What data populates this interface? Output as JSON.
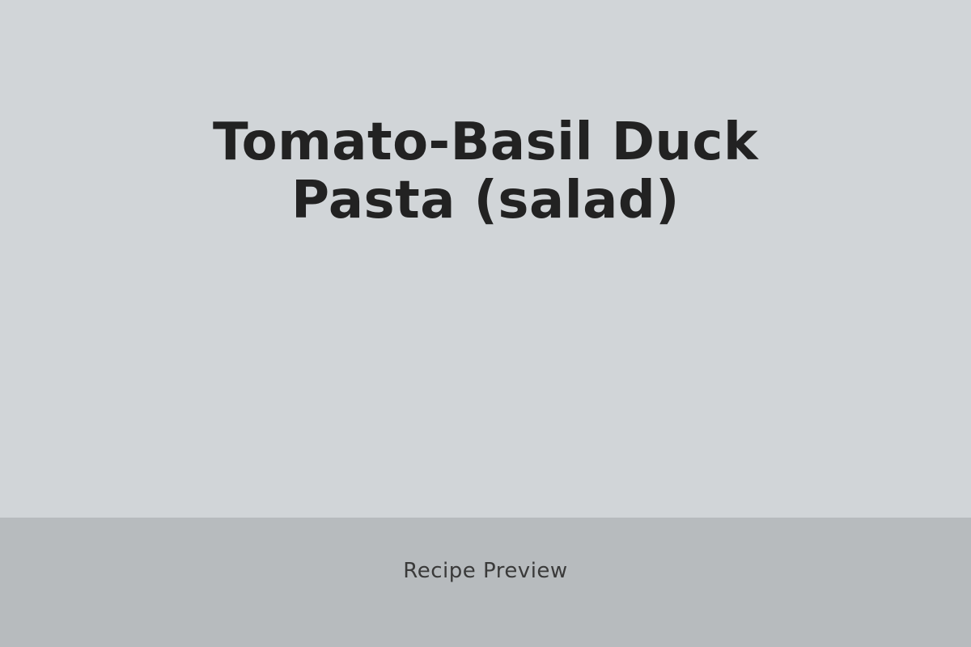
{
  "recipe": {
    "title_line1": "Tomato-Basil Duck",
    "title_line2": "Pasta (salad)"
  },
  "footer": {
    "label": "Recipe Preview"
  },
  "colors": {
    "hero_background": "#d1d5d8",
    "footer_background": "#b7bbbe",
    "title_text": "#222222",
    "footer_text": "#3a3a3a"
  }
}
